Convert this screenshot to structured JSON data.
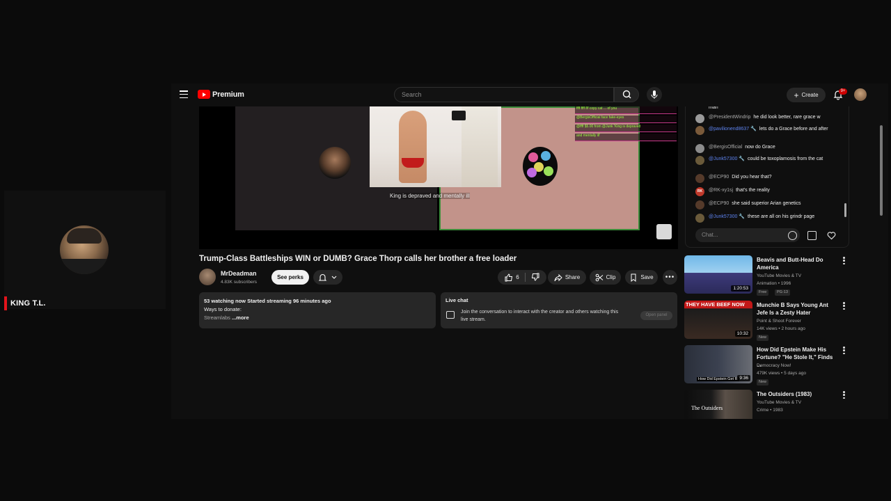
{
  "overlay": {
    "streamer_name": "KING T.L."
  },
  "topbar": {
    "brand": "Premium",
    "search_placeholder": "Search",
    "create_label": "Create",
    "notification_count": "9+"
  },
  "player": {
    "caption": "King is depraved and mentally ill",
    "chat_overlay_rows": [
      "ffff ffff  f/f copy cat ... of you",
      "@BergisOfficial  face fake-eyes",
      "@ffff  $5.00 from @Junk  'King is depraved",
      "and mentally ill'"
    ]
  },
  "video": {
    "title": "Trump-Class Battleships WIN or DUMB? Grace Thorp calls her brother a free loader",
    "channel_name": "MrDeadman",
    "channel_subs": "4.83K subscribers",
    "see_perks_label": "See perks",
    "like_count": "6",
    "share_label": "Share",
    "clip_label": "Clip",
    "save_label": "Save",
    "description": {
      "stats": "53 watching now  Started streaming 96 minutes ago",
      "line2": "Ways to donate:",
      "line3": "Streamlabs",
      "more": "...more"
    },
    "live_chat_box": {
      "heading": "Live chat",
      "message": "Join the conversation to interact with the creator and others watching this live stream.",
      "open_label": "Open panel"
    }
  },
  "chat": {
    "messages": [
      {
        "author": "",
        "text": "man",
        "avatar_color": "#444",
        "mod": false
      },
      {
        "author": "@PresidentWindrip",
        "text": "he did look better, rare grace w",
        "avatar_color": "#9a9a9a",
        "mod": false
      },
      {
        "author": "@pavilionend8637 🔧",
        "text": "lets do a Grace before and after",
        "avatar_color": "#7a5a3a",
        "mod": true
      },
      {
        "author": "@BergisOfficial",
        "text": "now do Grace",
        "avatar_color": "#8c8c8c",
        "mod": false
      },
      {
        "author": "@Junk57300 🔧",
        "text": "could be toxoplamosis from the cat",
        "avatar_color": "#6a5a3a",
        "mod": true
      },
      {
        "author": "@ECP90",
        "text": "Did you hear that?",
        "avatar_color": "#553a2a",
        "mod": false
      },
      {
        "author": "@RK-xy1sj",
        "text": "that's the reality",
        "avatar_color": "#c0392b",
        "avatar_text": "RK",
        "mod": false
      },
      {
        "author": "@ECP90",
        "text": "she said superior Arian genetics",
        "avatar_color": "#553a2a",
        "mod": false
      },
      {
        "author": "@Junk57300 🔧",
        "text": "these are all on his grindr page",
        "avatar_color": "#6a5a3a",
        "mod": true
      }
    ],
    "input_placeholder": "Chat..."
  },
  "recommendations": [
    {
      "title": "Beavis and Butt-Head Do America",
      "channel": "YouTube Movies & TV",
      "meta": "Animation • 1996",
      "tags": [
        "Free",
        "PG-13"
      ],
      "duration": "1:20:53"
    },
    {
      "title": "Munchie B Says Young Ant Jefe Is a Zesty Hater",
      "channel": "Point & Shoot Forever",
      "meta": "14K views • 2 hours ago",
      "tags": [
        "New"
      ],
      "duration": "10:32",
      "thumb_text": "THEY HAVE BEEF NOW"
    },
    {
      "title": "How Did Epstein Make His Fortune? \"He Stole It,\" Finds ...",
      "channel": "Democracy Now!",
      "meta": "479K views • 5 days ago",
      "tags": [
        "New"
      ],
      "duration": "9:36",
      "thumb_text": "How Did Epstein Get R"
    },
    {
      "title": "The Outsiders (1983)",
      "channel": "YouTube Movies & TV",
      "meta": "Crime • 1983",
      "tags": [],
      "duration": "",
      "thumb_text": "The Outsiders"
    }
  ],
  "colors": {
    "brand_red": "#ff0000",
    "overlay_accent": "#e3141b",
    "mod_blue": "#5e84f1",
    "player_border_green": "#3d8d3b"
  }
}
